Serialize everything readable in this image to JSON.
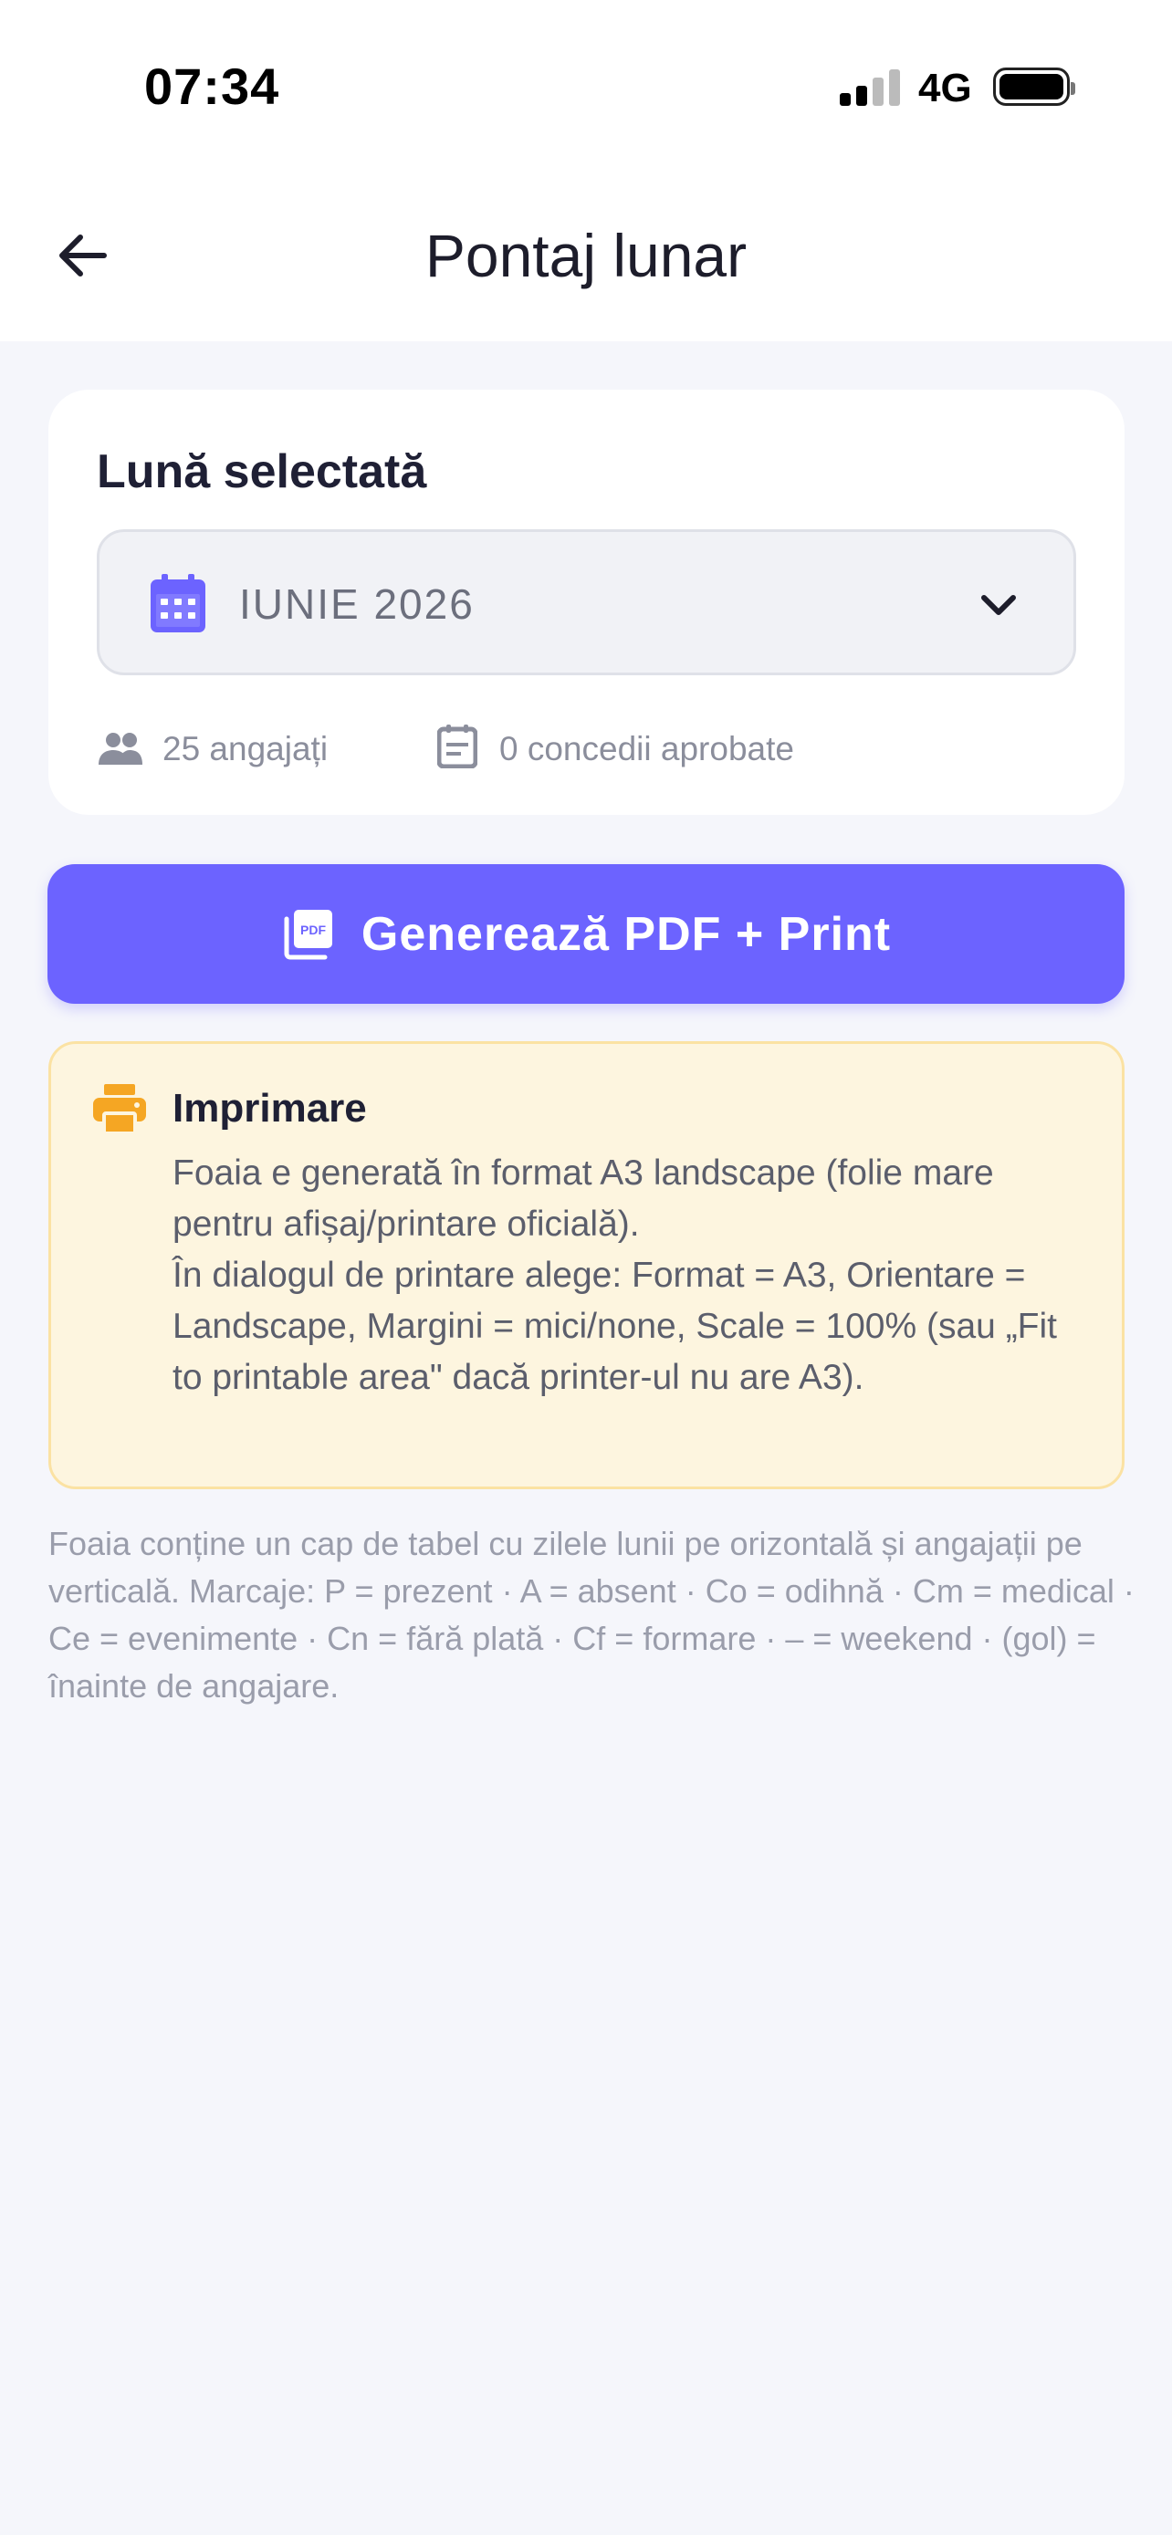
{
  "status_bar": {
    "time": "07:34",
    "network": "4G"
  },
  "header": {
    "title": "Pontaj lunar",
    "back_icon": "arrow-left-icon"
  },
  "month_card": {
    "label": "Lună selectată",
    "selected_month": "IUNIE 2026",
    "employees": "25 angajați",
    "leaves": "0 concedii aprobate"
  },
  "generate_button": {
    "label": "Generează PDF + Print",
    "icon": "pdf-icon"
  },
  "print_info": {
    "title": "Imprimare",
    "line1": "Foaia e generată în format A3 landscape (folie mare pentru afișaj/printare oficială).",
    "line2": "În dialogul de printare alege: Format = A3, Orientare = Landscape, Margini = mici/none, Scale = 100% (sau „Fit to printable area\" dacă printer-ul nu are A3)."
  },
  "legend_note": "Foaia conține un cap de tabel cu zilele lunii pe orizontală și angajații pe verticală. Marcaje: P = prezent · A = absent · Co = odihnă · Cm = medical · Ce = evenimente · Cn = fără plată · Cf = formare · – = weekend · (gol) = înainte de angajare.",
  "colors": {
    "accent": "#6c63ff",
    "info_bg": "#fdf5df",
    "info_border": "#fbe2a3",
    "printer_icon": "#f5a623"
  }
}
